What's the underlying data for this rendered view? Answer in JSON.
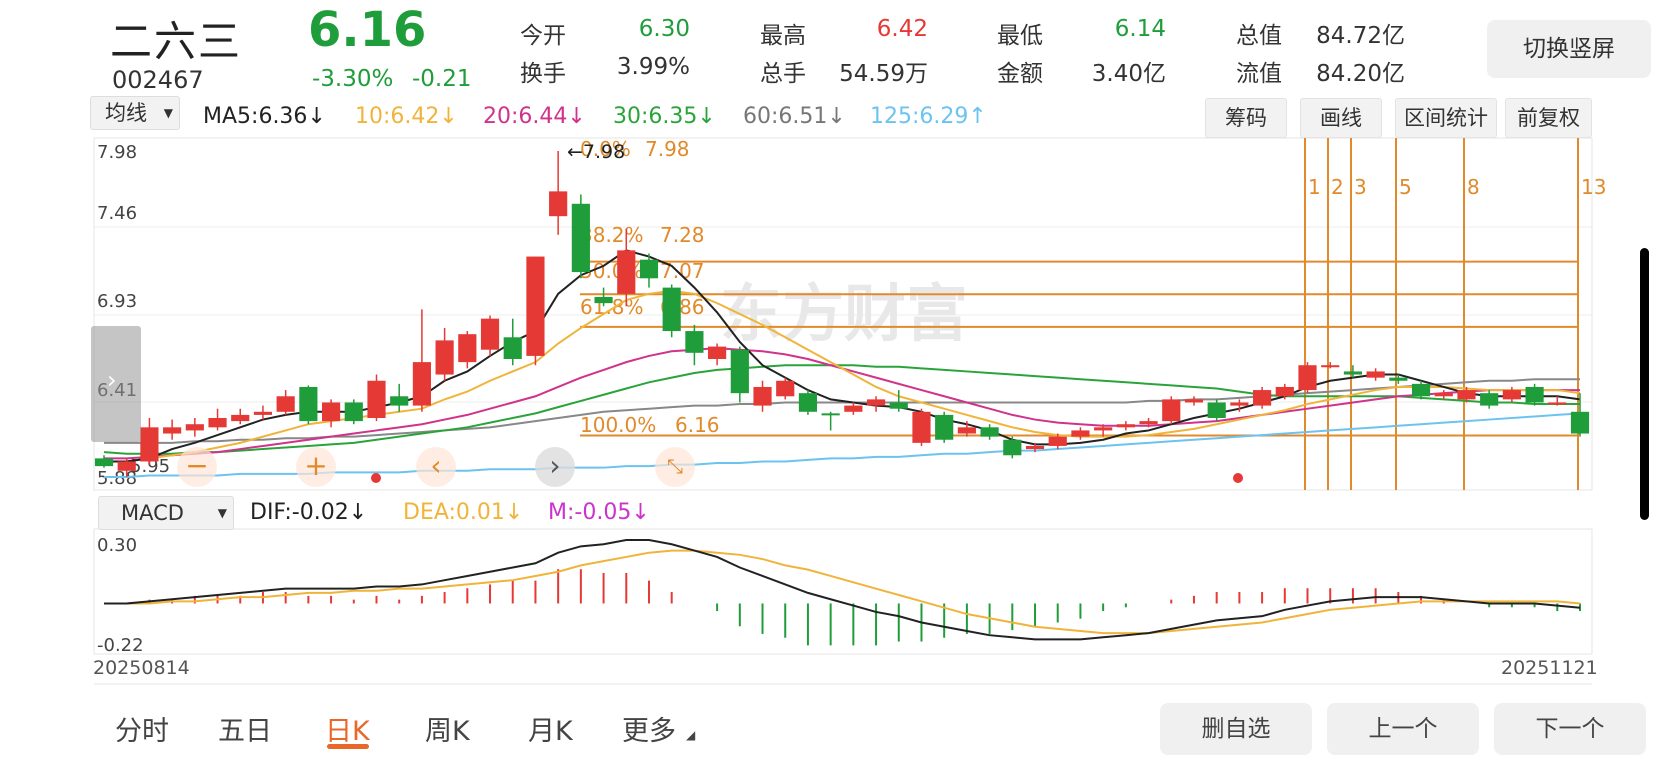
{
  "stock": {
    "name": "二六三",
    "code": "002467",
    "price": "6.16",
    "change_pct": "-3.30%",
    "change": "-0.21"
  },
  "quote": [
    {
      "label": "今开",
      "value": "6.30",
      "color": "green"
    },
    {
      "label": "最高",
      "value": "6.42",
      "color": "red"
    },
    {
      "label": "最低",
      "value": "6.14",
      "color": "green"
    },
    {
      "label": "总值",
      "value": "84.72亿",
      "color": "dark"
    },
    {
      "label": "换手",
      "value": "3.99%",
      "color": "dark"
    },
    {
      "label": "总手",
      "value": "54.59万",
      "color": "dark"
    },
    {
      "label": "金额",
      "value": "3.40亿",
      "color": "dark"
    },
    {
      "label": "流值",
      "value": "84.20亿",
      "color": "dark"
    }
  ],
  "switch_label": "切换竖屏",
  "indicator_select": "均线",
  "ma_legend": [
    {
      "text": "MA5:6.36",
      "arrow": "↓",
      "color": "#222222"
    },
    {
      "text": "10:6.42",
      "arrow": "↓",
      "color": "#f0b43a"
    },
    {
      "text": "20:6.44",
      "arrow": "↓",
      "color": "#d0338a"
    },
    {
      "text": "30:6.35",
      "arrow": "↓",
      "color": "#2aa43a"
    },
    {
      "text": "60:6.51",
      "arrow": "↓",
      "color": "#777777"
    },
    {
      "text": "125:6.29",
      "arrow": "↑",
      "color": "#6cc3f0"
    }
  ],
  "chart_buttons": [
    "筹码",
    "画线",
    "区间统计",
    "前复权"
  ],
  "price_axis": [
    "7.98",
    "7.46",
    "6.93",
    "6.41",
    "5.95",
    "5.88"
  ],
  "fib_labels": [
    {
      "pct": "0.0%",
      "price": "7.98",
      "tag": "7.98"
    },
    {
      "pct": "38.2%",
      "price": "7.28"
    },
    {
      "pct": "50.0%",
      "price": "7.07"
    },
    {
      "pct": "61.8%",
      "price": "6.86"
    },
    {
      "pct": "100.0%",
      "price": "6.16"
    }
  ],
  "time_cycle_labels": [
    "1",
    "2",
    "3",
    "5",
    "8",
    "13"
  ],
  "macd_select": "MACD",
  "macd_legend": [
    {
      "text": "DIF:-0.02",
      "arrow": "↓",
      "color": "#222222"
    },
    {
      "text": "DEA:0.01",
      "arrow": "↓",
      "color": "#f0b43a"
    },
    {
      "text": "M:-0.05",
      "arrow": "↓",
      "color": "#cc33cc"
    }
  ],
  "macd_axis": [
    "0.30",
    "-0.22"
  ],
  "date_start": "20250814",
  "date_end": "20251121",
  "watermark": "东方财富",
  "period_tabs": [
    "分时",
    "五日",
    "日K",
    "周K",
    "月K",
    "更多"
  ],
  "active_tab": "日K",
  "bottom_buttons": [
    "删自选",
    "上一个",
    "下一个"
  ],
  "colors": {
    "up": "#e53935",
    "down": "#1f9d3a",
    "fib": "#e08a2c"
  },
  "chart_data": {
    "type": "candlestick",
    "ylim": [
      5.88,
      7.98
    ],
    "candles": [
      {
        "o": 6.0,
        "c": 5.95,
        "h": 6.02,
        "l": 5.94
      },
      {
        "o": 5.92,
        "c": 5.98,
        "h": 6.0,
        "l": 5.88
      },
      {
        "o": 5.98,
        "c": 6.2,
        "h": 6.26,
        "l": 5.96
      },
      {
        "o": 6.16,
        "c": 6.2,
        "h": 6.25,
        "l": 6.12
      },
      {
        "o": 6.18,
        "c": 6.22,
        "h": 6.26,
        "l": 6.14
      },
      {
        "o": 6.2,
        "c": 6.26,
        "h": 6.32,
        "l": 6.18
      },
      {
        "o": 6.24,
        "c": 6.28,
        "h": 6.32,
        "l": 6.22
      },
      {
        "o": 6.28,
        "c": 6.3,
        "h": 6.34,
        "l": 6.25
      },
      {
        "o": 6.3,
        "c": 6.4,
        "h": 6.44,
        "l": 6.28
      },
      {
        "o": 6.46,
        "c": 6.24,
        "h": 6.47,
        "l": 6.22
      },
      {
        "o": 6.24,
        "c": 6.36,
        "h": 6.38,
        "l": 6.2
      },
      {
        "o": 6.36,
        "c": 6.24,
        "h": 6.38,
        "l": 6.22
      },
      {
        "o": 6.26,
        "c": 6.5,
        "h": 6.54,
        "l": 6.24
      },
      {
        "o": 6.4,
        "c": 6.34,
        "h": 6.48,
        "l": 6.3
      },
      {
        "o": 6.34,
        "c": 6.62,
        "h": 6.96,
        "l": 6.3
      },
      {
        "o": 6.54,
        "c": 6.76,
        "h": 6.84,
        "l": 6.5
      },
      {
        "o": 6.62,
        "c": 6.8,
        "h": 6.82,
        "l": 6.58
      },
      {
        "o": 6.7,
        "c": 6.9,
        "h": 6.92,
        "l": 6.66
      },
      {
        "o": 6.78,
        "c": 6.64,
        "h": 6.9,
        "l": 6.6
      },
      {
        "o": 6.66,
        "c": 7.3,
        "h": 7.3,
        "l": 6.6
      },
      {
        "o": 7.56,
        "c": 7.72,
        "h": 7.98,
        "l": 7.44
      },
      {
        "o": 7.64,
        "c": 7.2,
        "h": 7.7,
        "l": 7.16
      },
      {
        "o": 7.04,
        "c": 7.0,
        "h": 7.1,
        "l": 6.98
      },
      {
        "o": 7.06,
        "c": 7.34,
        "h": 7.48,
        "l": 6.98
      },
      {
        "o": 7.28,
        "c": 7.16,
        "h": 7.32,
        "l": 7.1
      },
      {
        "o": 7.1,
        "c": 6.82,
        "h": 7.12,
        "l": 6.78
      },
      {
        "o": 6.82,
        "c": 6.68,
        "h": 6.86,
        "l": 6.6
      },
      {
        "o": 6.64,
        "c": 6.72,
        "h": 6.74,
        "l": 6.6
      },
      {
        "o": 6.7,
        "c": 6.42,
        "h": 6.72,
        "l": 6.36
      },
      {
        "o": 6.34,
        "c": 6.46,
        "h": 6.5,
        "l": 6.3
      },
      {
        "o": 6.4,
        "c": 6.5,
        "h": 6.52,
        "l": 6.38
      },
      {
        "o": 6.42,
        "c": 6.3,
        "h": 6.44,
        "l": 6.28
      },
      {
        "o": 6.29,
        "c": 6.28,
        "h": 6.3,
        "l": 6.18
      },
      {
        "o": 6.3,
        "c": 6.34,
        "h": 6.36,
        "l": 6.28
      },
      {
        "o": 6.34,
        "c": 6.38,
        "h": 6.4,
        "l": 6.3
      },
      {
        "o": 6.36,
        "c": 6.32,
        "h": 6.44,
        "l": 6.3
      },
      {
        "o": 6.1,
        "c": 6.3,
        "h": 6.32,
        "l": 6.08
      },
      {
        "o": 6.28,
        "c": 6.12,
        "h": 6.3,
        "l": 6.1
      },
      {
        "o": 6.16,
        "c": 6.2,
        "h": 6.24,
        "l": 6.14
      },
      {
        "o": 6.2,
        "c": 6.14,
        "h": 6.22,
        "l": 6.12
      },
      {
        "o": 6.12,
        "c": 6.02,
        "h": 6.14,
        "l": 6.0
      },
      {
        "o": 6.06,
        "c": 6.08,
        "h": 6.1,
        "l": 6.04
      },
      {
        "o": 6.08,
        "c": 6.14,
        "h": 6.16,
        "l": 6.06
      },
      {
        "o": 6.14,
        "c": 6.18,
        "h": 6.2,
        "l": 6.12
      },
      {
        "o": 6.18,
        "c": 6.2,
        "h": 6.22,
        "l": 6.14
      },
      {
        "o": 6.2,
        "c": 6.22,
        "h": 6.24,
        "l": 6.18
      },
      {
        "o": 6.22,
        "c": 6.24,
        "h": 6.26,
        "l": 6.2
      },
      {
        "o": 6.24,
        "c": 6.38,
        "h": 6.4,
        "l": 6.22
      },
      {
        "o": 6.36,
        "c": 6.38,
        "h": 6.4,
        "l": 6.34
      },
      {
        "o": 6.36,
        "c": 6.26,
        "h": 6.38,
        "l": 6.24
      },
      {
        "o": 6.34,
        "c": 6.36,
        "h": 6.38,
        "l": 6.3
      },
      {
        "o": 6.34,
        "c": 6.44,
        "h": 6.46,
        "l": 6.32
      },
      {
        "o": 6.4,
        "c": 6.46,
        "h": 6.48,
        "l": 6.38
      },
      {
        "o": 6.44,
        "c": 6.6,
        "h": 6.62,
        "l": 6.42
      },
      {
        "o": 6.6,
        "c": 6.6,
        "h": 6.62,
        "l": 6.58
      },
      {
        "o": 6.56,
        "c": 6.54,
        "h": 6.6,
        "l": 6.52
      },
      {
        "o": 6.52,
        "c": 6.56,
        "h": 6.58,
        "l": 6.5
      },
      {
        "o": 6.52,
        "c": 6.5,
        "h": 6.54,
        "l": 6.48
      },
      {
        "o": 6.48,
        "c": 6.4,
        "h": 6.5,
        "l": 6.38
      },
      {
        "o": 6.4,
        "c": 6.42,
        "h": 6.44,
        "l": 6.38
      },
      {
        "o": 6.38,
        "c": 6.44,
        "h": 6.46,
        "l": 6.36
      },
      {
        "o": 6.42,
        "c": 6.34,
        "h": 6.44,
        "l": 6.32
      },
      {
        "o": 6.38,
        "c": 6.44,
        "h": 6.46,
        "l": 6.36
      },
      {
        "o": 6.46,
        "c": 6.36,
        "h": 6.48,
        "l": 6.34
      },
      {
        "o": 6.36,
        "c": 6.36,
        "h": 6.4,
        "l": 6.34
      },
      {
        "o": 6.3,
        "c": 6.16,
        "h": 6.42,
        "l": 6.14
      }
    ],
    "ma5": [
      5.98,
      5.98,
      6.0,
      6.06,
      6.1,
      6.15,
      6.2,
      6.25,
      6.28,
      6.3,
      6.3,
      6.3,
      6.33,
      6.36,
      6.4,
      6.5,
      6.56,
      6.66,
      6.75,
      6.82,
      7.06,
      7.18,
      7.24,
      7.34,
      7.3,
      7.24,
      7.1,
      6.94,
      6.75,
      6.6,
      6.52,
      6.44,
      6.38,
      6.36,
      6.34,
      6.33,
      6.3,
      6.25,
      6.22,
      6.18,
      6.12,
      6.09,
      6.09,
      6.1,
      6.12,
      6.16,
      6.18,
      6.22,
      6.26,
      6.29,
      6.32,
      6.36,
      6.4,
      6.46,
      6.5,
      6.52,
      6.54,
      6.54,
      6.5,
      6.46,
      6.42,
      6.4,
      6.4,
      6.4,
      6.4,
      6.38
    ],
    "ma10": [
      5.98,
      5.98,
      6.0,
      6.02,
      6.04,
      6.07,
      6.1,
      6.14,
      6.18,
      6.22,
      6.24,
      6.26,
      6.28,
      6.3,
      6.32,
      6.38,
      6.43,
      6.5,
      6.56,
      6.62,
      6.74,
      6.84,
      6.93,
      7.02,
      7.06,
      7.08,
      7.06,
      7.0,
      6.93,
      6.86,
      6.78,
      6.7,
      6.62,
      6.54,
      6.46,
      6.4,
      6.36,
      6.32,
      6.28,
      6.24,
      6.2,
      6.17,
      6.15,
      6.14,
      6.14,
      6.14,
      6.15,
      6.17,
      6.19,
      6.22,
      6.25,
      6.28,
      6.31,
      6.35,
      6.38,
      6.41,
      6.44,
      6.46,
      6.46,
      6.46,
      6.45,
      6.44,
      6.44,
      6.44,
      6.44,
      6.42
    ],
    "ma20": [
      6.0,
      6.0,
      6.01,
      6.02,
      6.03,
      6.04,
      6.06,
      6.08,
      6.1,
      6.12,
      6.14,
      6.16,
      6.18,
      6.2,
      6.22,
      6.25,
      6.28,
      6.32,
      6.36,
      6.4,
      6.46,
      6.52,
      6.57,
      6.62,
      6.66,
      6.69,
      6.7,
      6.71,
      6.7,
      6.69,
      6.67,
      6.64,
      6.6,
      6.56,
      6.52,
      6.48,
      6.44,
      6.4,
      6.36,
      6.32,
      6.28,
      6.25,
      6.23,
      6.22,
      6.21,
      6.21,
      6.21,
      6.22,
      6.23,
      6.24,
      6.26,
      6.28,
      6.3,
      6.32,
      6.34,
      6.36,
      6.38,
      6.4,
      6.41,
      6.42,
      6.43,
      6.44,
      6.44,
      6.44,
      6.44,
      6.44
    ],
    "ma30": [
      6.04,
      6.03,
      6.03,
      6.03,
      6.04,
      6.04,
      6.05,
      6.06,
      6.07,
      6.08,
      6.09,
      6.1,
      6.12,
      6.14,
      6.16,
      6.18,
      6.2,
      6.23,
      6.26,
      6.29,
      6.33,
      6.37,
      6.41,
      6.45,
      6.49,
      6.52,
      6.55,
      6.57,
      6.58,
      6.59,
      6.6,
      6.6,
      6.6,
      6.6,
      6.59,
      6.59,
      6.58,
      6.57,
      6.56,
      6.55,
      6.54,
      6.53,
      6.52,
      6.51,
      6.5,
      6.49,
      6.48,
      6.47,
      6.46,
      6.45,
      6.43,
      6.41,
      6.4,
      6.4,
      6.4,
      6.4,
      6.4,
      6.4,
      6.39,
      6.38,
      6.37,
      6.36,
      6.36,
      6.35,
      6.35,
      6.35
    ],
    "ma60": [
      6.1,
      6.1,
      6.1,
      6.1,
      6.11,
      6.11,
      6.12,
      6.12,
      6.13,
      6.13,
      6.14,
      6.14,
      6.15,
      6.16,
      6.17,
      6.18,
      6.19,
      6.2,
      6.22,
      6.24,
      6.26,
      6.28,
      6.3,
      6.31,
      6.32,
      6.33,
      6.34,
      6.34,
      6.35,
      6.35,
      6.36,
      6.36,
      6.36,
      6.36,
      6.36,
      6.36,
      6.36,
      6.36,
      6.36,
      6.36,
      6.36,
      6.36,
      6.36,
      6.36,
      6.36,
      6.36,
      6.37,
      6.37,
      6.38,
      6.38,
      6.39,
      6.4,
      6.41,
      6.42,
      6.43,
      6.44,
      6.45,
      6.46,
      6.47,
      6.48,
      6.49,
      6.5,
      6.5,
      6.51,
      6.51,
      6.51
    ],
    "ma125": [
      5.88,
      5.88,
      5.89,
      5.89,
      5.89,
      5.89,
      5.9,
      5.9,
      5.9,
      5.9,
      5.91,
      5.91,
      5.91,
      5.91,
      5.92,
      5.92,
      5.92,
      5.93,
      5.93,
      5.93,
      5.94,
      5.94,
      5.94,
      5.95,
      5.95,
      5.96,
      5.96,
      5.97,
      5.97,
      5.98,
      5.98,
      5.99,
      6.0,
      6.0,
      6.01,
      6.01,
      6.02,
      6.03,
      6.03,
      6.04,
      6.05,
      6.05,
      6.06,
      6.07,
      6.08,
      6.09,
      6.1,
      6.11,
      6.12,
      6.13,
      6.14,
      6.15,
      6.16,
      6.17,
      6.18,
      6.19,
      6.2,
      6.21,
      6.22,
      6.23,
      6.24,
      6.25,
      6.26,
      6.27,
      6.28,
      6.29
    ],
    "macd_ylim": [
      -0.22,
      0.3
    ],
    "dif": [
      0.0,
      0.0,
      0.01,
      0.02,
      0.03,
      0.04,
      0.05,
      0.06,
      0.07,
      0.07,
      0.07,
      0.07,
      0.08,
      0.08,
      0.09,
      0.11,
      0.13,
      0.15,
      0.17,
      0.19,
      0.24,
      0.27,
      0.28,
      0.3,
      0.3,
      0.28,
      0.25,
      0.22,
      0.17,
      0.13,
      0.09,
      0.05,
      0.02,
      -0.01,
      -0.04,
      -0.06,
      -0.09,
      -0.11,
      -0.13,
      -0.15,
      -0.16,
      -0.17,
      -0.17,
      -0.17,
      -0.16,
      -0.15,
      -0.14,
      -0.12,
      -0.1,
      -0.08,
      -0.07,
      -0.06,
      -0.03,
      -0.01,
      0.01,
      0.02,
      0.03,
      0.03,
      0.03,
      0.02,
      0.01,
      0.0,
      0.0,
      0.0,
      -0.01,
      -0.02
    ],
    "dea": [
      0.0,
      0.0,
      0.0,
      0.01,
      0.01,
      0.02,
      0.03,
      0.03,
      0.04,
      0.05,
      0.05,
      0.06,
      0.06,
      0.07,
      0.07,
      0.08,
      0.09,
      0.1,
      0.11,
      0.13,
      0.15,
      0.18,
      0.2,
      0.22,
      0.24,
      0.25,
      0.25,
      0.24,
      0.23,
      0.21,
      0.18,
      0.16,
      0.13,
      0.1,
      0.07,
      0.04,
      0.01,
      -0.02,
      -0.05,
      -0.07,
      -0.09,
      -0.11,
      -0.12,
      -0.13,
      -0.14,
      -0.14,
      -0.14,
      -0.13,
      -0.12,
      -0.11,
      -0.1,
      -0.09,
      -0.07,
      -0.05,
      -0.03,
      -0.02,
      -0.01,
      0.0,
      0.01,
      0.01,
      0.01,
      0.01,
      0.01,
      0.01,
      0.01,
      0.0
    ]
  }
}
